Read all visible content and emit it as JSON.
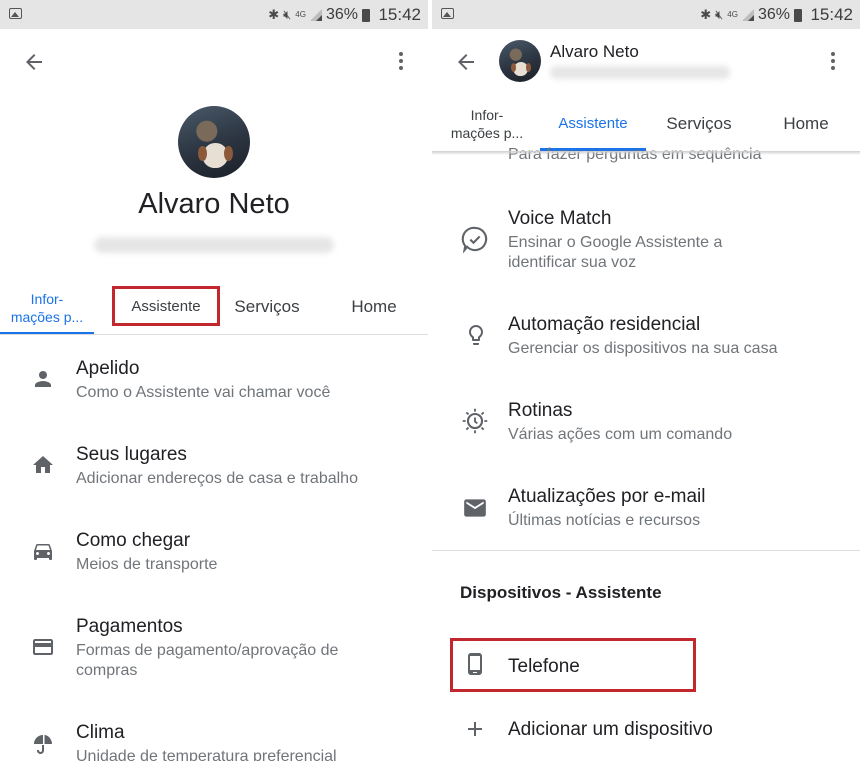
{
  "status_bar": {
    "battery_pct": "36%",
    "time": "15:42",
    "network": "4G"
  },
  "left": {
    "profile_name": "Alvaro Neto",
    "tabs": [
      {
        "label_line1": "Infor-",
        "label_line2": "mações p...",
        "active": true
      },
      {
        "label": "Assistente",
        "active": false,
        "highlighted": true
      },
      {
        "label": "Serviços",
        "active": false
      },
      {
        "label": "Home",
        "active": false
      }
    ],
    "items": [
      {
        "title": "Apelido",
        "subtitle": "Como o Assistente vai chamar você",
        "icon": "person-icon"
      },
      {
        "title": "Seus lugares",
        "subtitle": "Adicionar endereços de casa e trabalho",
        "icon": "home-icon"
      },
      {
        "title": "Como chegar",
        "subtitle": "Meios de transporte",
        "icon": "car-icon"
      },
      {
        "title": "Pagamentos",
        "subtitle": "Formas de pagamento/aprovação de compras",
        "icon": "credit-card-icon"
      },
      {
        "title": "Clima",
        "subtitle": "Unidade de temperatura preferencial",
        "icon": "weather-icon"
      }
    ]
  },
  "right": {
    "profile_name": "Alvaro Neto",
    "tabs": [
      {
        "label_line1": "Infor-",
        "label_line2": "mações p...",
        "active": false
      },
      {
        "label": "Assistente",
        "active": true
      },
      {
        "label": "Serviços",
        "active": false
      },
      {
        "label": "Home",
        "active": false
      }
    ],
    "partial_item_subtitle": "Para fazer perguntas em sequência",
    "items": [
      {
        "title": "Voice Match",
        "subtitle": "Ensinar o Google Assistente a identificar sua voz",
        "icon": "voice-match-icon"
      },
      {
        "title": "Automação residencial",
        "subtitle": "Gerenciar os dispositivos na sua casa",
        "icon": "lightbulb-icon"
      },
      {
        "title": "Rotinas",
        "subtitle": "Várias ações com um comando",
        "icon": "routines-icon"
      },
      {
        "title": "Atualizações por e-mail",
        "subtitle": "Últimas notícias e recursos",
        "icon": "email-icon"
      }
    ],
    "section_title": "Dispositivos - Assistente",
    "devices": [
      {
        "title": "Telefone",
        "icon": "phone-icon",
        "highlighted": true
      },
      {
        "title": "Adicionar um dispositivo",
        "icon": "plus-icon"
      }
    ]
  },
  "colors": {
    "accent": "#1a73e8",
    "highlight_box": "#c2272d",
    "status_bar": "#e5e5e5"
  }
}
